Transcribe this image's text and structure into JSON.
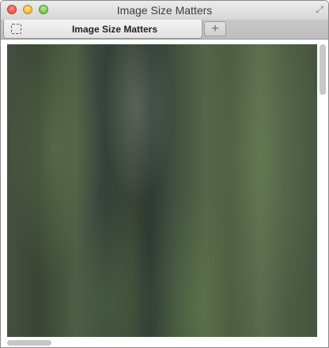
{
  "window": {
    "title": "Image Size Matters"
  },
  "tab": {
    "label": "Image Size Matters"
  },
  "new_tab": {
    "label": "+"
  },
  "content": {
    "image_alt": ""
  },
  "colors": {
    "titlebar": "#dcdcdc",
    "tab_active": "#ececec"
  }
}
